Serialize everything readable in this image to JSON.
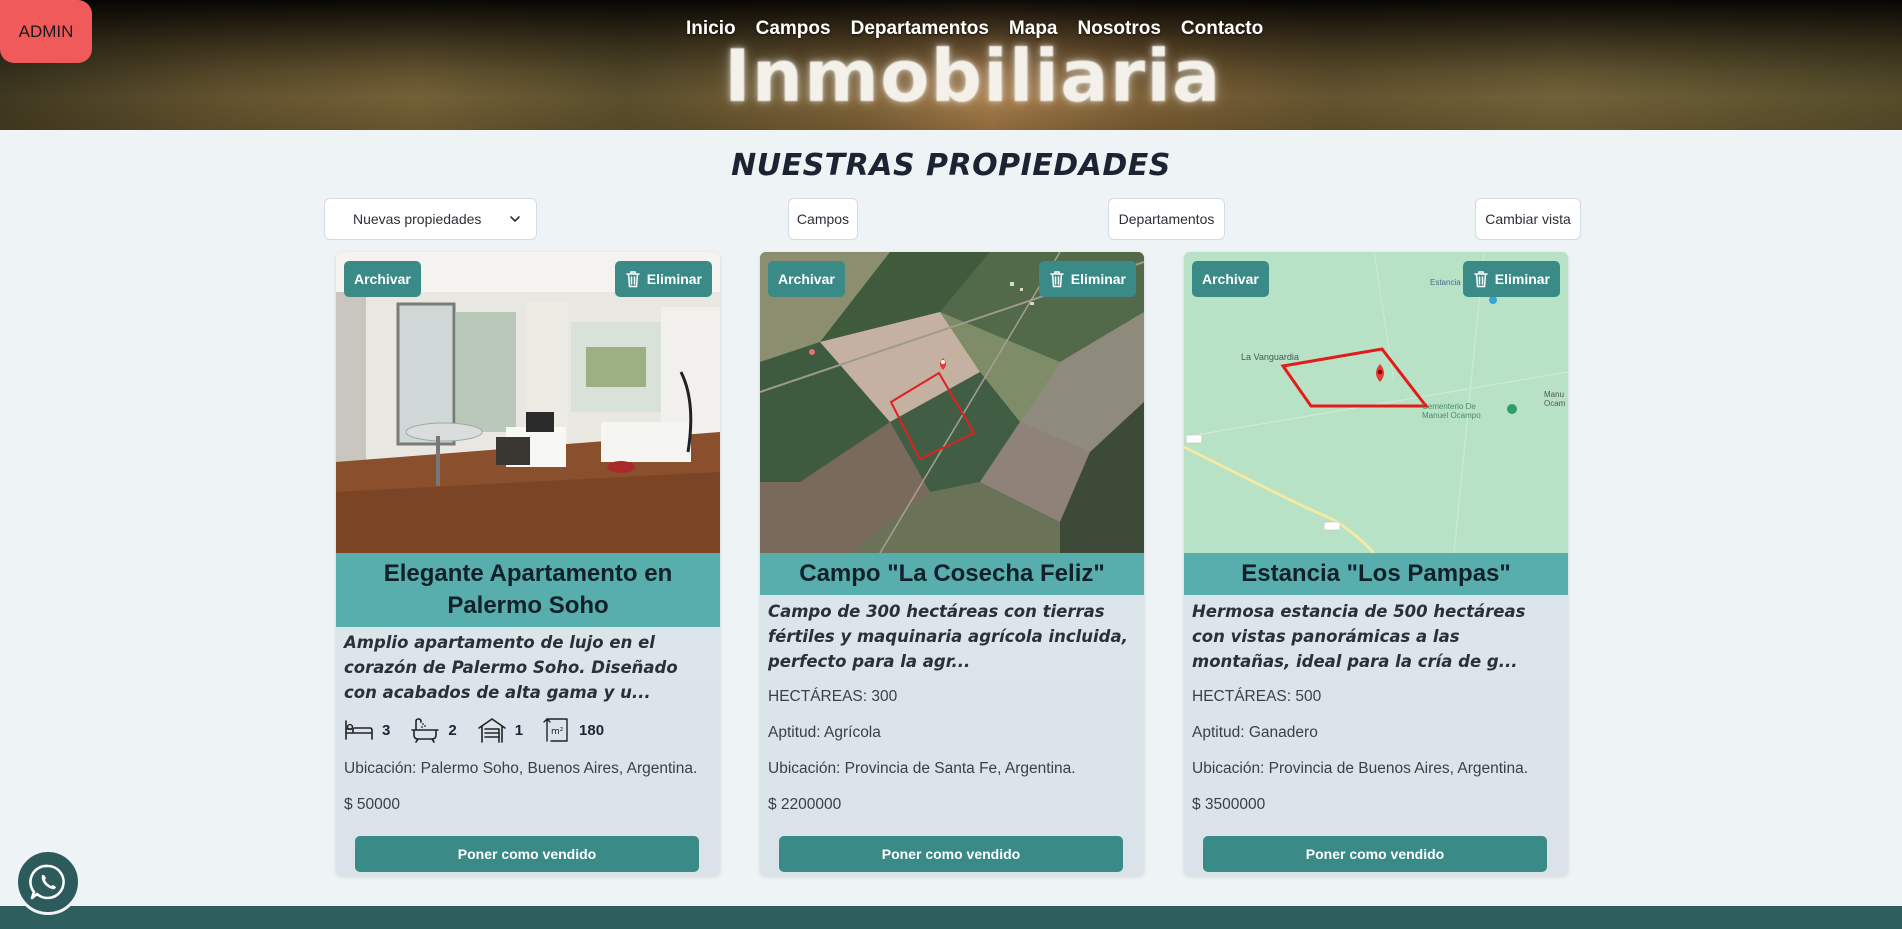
{
  "admin": {
    "label": "ADMIN"
  },
  "nav": {
    "items": [
      "Inicio",
      "Campos",
      "Departamentos",
      "Mapa",
      "Nosotros",
      "Contacto"
    ]
  },
  "brand": {
    "title": "Inmobiliaria"
  },
  "section": {
    "title": "NUESTRAS PROPIEDADES"
  },
  "filters": {
    "sort_selected": "Nuevas propiedades",
    "campos": "Campos",
    "departamentos": "Departamentos",
    "cambiar_vista": "Cambiar vista"
  },
  "card_actions": {
    "archive": "Archivar",
    "delete": "Eliminar",
    "mark_sold": "Poner como vendido"
  },
  "properties": [
    {
      "title": "Elegante Apartamento en Palermo Soho",
      "description": "Amplio apartamento de lujo en el corazón de Palermo Soho. Diseñado con acabados de alta gama y u...",
      "bedrooms": "3",
      "bathrooms": "2",
      "garage": "1",
      "area": "180",
      "location": "Ubicación: Palermo Soho, Buenos Aires, Argentina.",
      "price": "$ 50000"
    },
    {
      "title": "Campo \"La Cosecha Feliz\"",
      "description": "Campo de 300 hectáreas con tierras fértiles y maquinaria agrícola incluida, perfecto para la agr...",
      "hectares": "HECTÁREAS: 300",
      "aptitude": "Aptitud: Agrícola",
      "location": "Ubicación: Provincia de Santa Fe, Argentina.",
      "price": "$ 2200000"
    },
    {
      "title": "Estancia \"Los Pampas\"",
      "description": "Hermosa estancia de 500 hectáreas con vistas panorámicas a las montañas, ideal para la cría de g...",
      "hectares": "HECTÁREAS: 500",
      "aptitude": "Aptitud: Ganadero",
      "location": "Ubicación: Provincia de Buenos Aires, Argentina.",
      "price": "$ 3500000",
      "map_labels": [
        "La Vanguardia",
        "Cementerio De Manuel Ocampo",
        "Estancia",
        "Manu Ocam"
      ]
    }
  ],
  "colors": {
    "accent": "#3a8a88",
    "title_bar": "#57aeac",
    "admin": "#f05a5b",
    "footer": "#2f5e5f"
  },
  "icons": [
    "bed-icon",
    "bathtub-icon",
    "garage-icon",
    "area-m2-icon",
    "trash-icon",
    "chevron-down-icon",
    "whatsapp-icon",
    "map-pin-icon"
  ]
}
